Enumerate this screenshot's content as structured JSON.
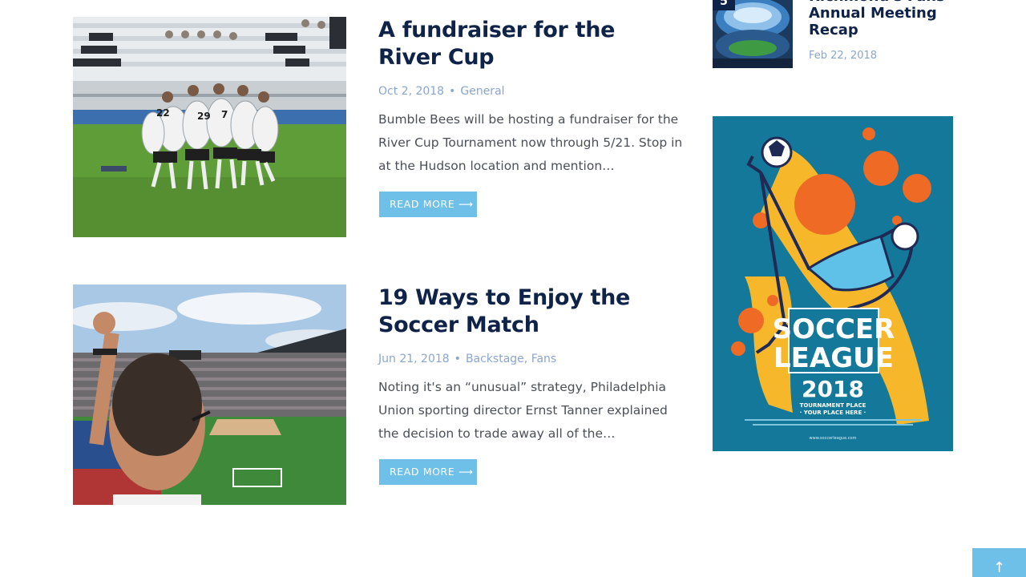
{
  "posts": [
    {
      "title": "A fundraiser for the River Cup",
      "date": "Oct 2, 2018",
      "category": "General",
      "excerpt": "Bumble Bees will be hosting a fundraiser for the River Cup Tournament now through 5/21. Stop in at the Hudson location and mention…",
      "read_more": "Read More ⟶"
    },
    {
      "title": "19 Ways to Enjoy the Soccer Match",
      "date": "Jun 21, 2018",
      "category": "Backstage, Fans",
      "excerpt": "Noting it's an “unusual” strategy, Philadelphia Union sporting director Ernst Tanner explained the decision to trade away all of the…",
      "read_more": "Read More ⟶"
    }
  ],
  "meta_separator": "•",
  "sidebar": {
    "recent": {
      "number": "5",
      "title": "Richmond's Fans Annual Meeting Recap",
      "date": "Feb 22, 2018"
    },
    "banner": {
      "line1": "SOCCER",
      "line2": "LEAGUE",
      "year": "2018",
      "sub1": "TOURNAMENT PLACE",
      "sub2": "· YOUR PLACE HERE ·",
      "url": "www.soccerleague.com"
    }
  },
  "back_to_top": "↑",
  "colors": {
    "title": "#0f2247",
    "meta": "#8aa6cf",
    "accent": "#6fc0e9",
    "banner_bg": "#14789a"
  }
}
